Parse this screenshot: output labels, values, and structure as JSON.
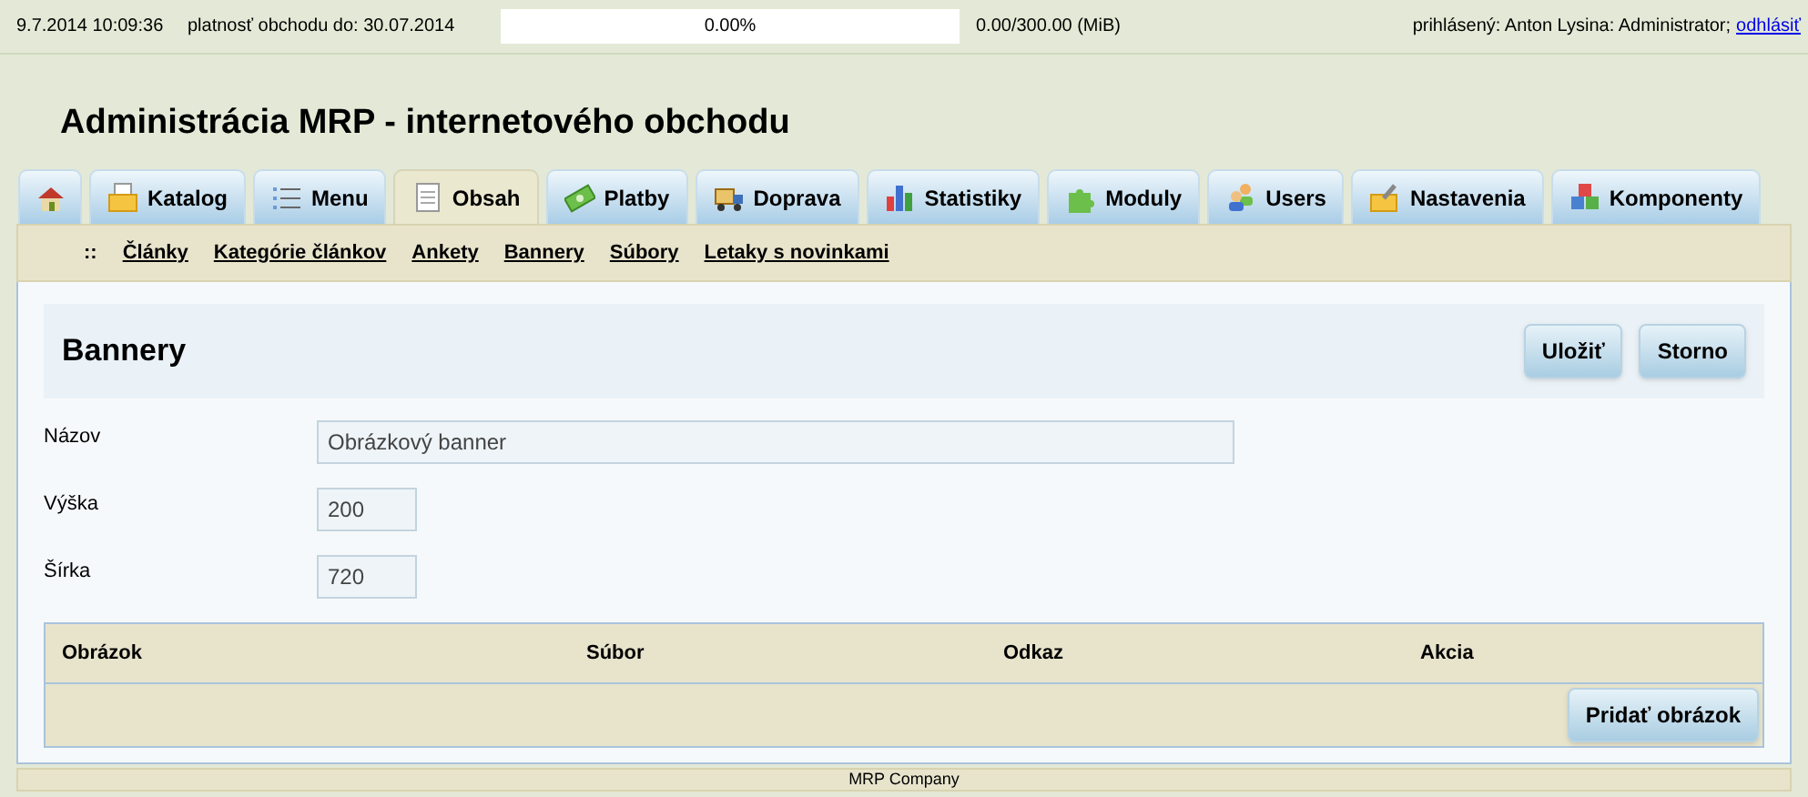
{
  "top_bar": {
    "datetime": "9.7.2014 10:09:36",
    "validity": "platnosť obchodu do: 30.07.2014",
    "storage": {
      "level": 0,
      "percent": "0.00%",
      "reading": "0.00/300.00 (MiB)"
    },
    "user": "prihlásený: Anton Lysina: Administrator;",
    "logout": "odhlásiť"
  },
  "title": "Administrácia MRP - internetového obchodu",
  "tabs": [
    {
      "selected": false
    },
    {
      "label": "Katalog",
      "selected": false
    },
    {
      "label": "Menu",
      "selected": false
    },
    {
      "label": "Obsah",
      "selected": true
    },
    {
      "label": "Platby",
      "selected": false
    },
    {
      "label": "Doprava",
      "selected": false
    },
    {
      "label": "Statistiky",
      "selected": false
    },
    {
      "label": "Moduly",
      "selected": false
    },
    {
      "label": "Users",
      "selected": false
    },
    {
      "label": "Nastavenia",
      "selected": false
    },
    {
      "label": "Komponenty",
      "selected": false
    }
  ],
  "subnav": {
    "marker": "::",
    "items": [
      "Články",
      "Kategórie článkov",
      "Ankety",
      "Bannery",
      "Súbory",
      "Letaky s novinkami"
    ]
  },
  "panel": {
    "title": "Bannery",
    "buttons": [
      "Uložiť",
      "Storno"
    ],
    "fields": [
      {
        "label": "Názov",
        "value": "Obrázkový banner",
        "kind": "wide"
      },
      {
        "label": "Výška",
        "value": "200",
        "kind": "short"
      },
      {
        "label": "Šírka",
        "value": "720",
        "kind": "short"
      }
    ],
    "table": {
      "columns": [
        "Obrázok",
        "Súbor",
        "Odkaz",
        "Akcia"
      ],
      "add_button": "Pridať obrázok"
    }
  },
  "footer": "MRP Company"
}
